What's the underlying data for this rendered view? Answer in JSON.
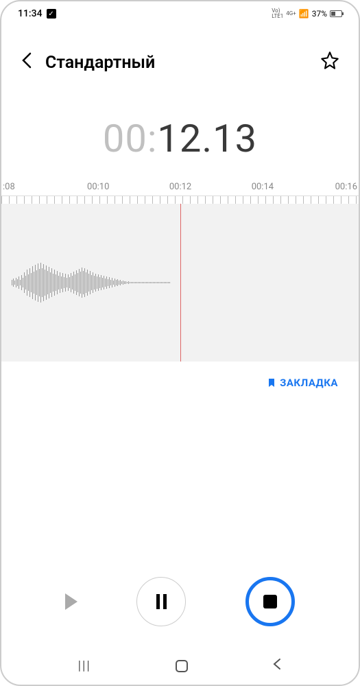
{
  "statusBar": {
    "time": "11:34",
    "network1": "Vo)",
    "network2": "LTE1",
    "signal": "4G+",
    "battery": "37%"
  },
  "header": {
    "title": "Стандартный"
  },
  "timer": {
    "grayPart": "00:",
    "darkPart": "12.13"
  },
  "timeline": {
    "labels": [
      ":08",
      "00:10",
      "00:12",
      "00:14",
      "00:16"
    ]
  },
  "bookmark": {
    "label": "ЗАКЛАДКА"
  }
}
